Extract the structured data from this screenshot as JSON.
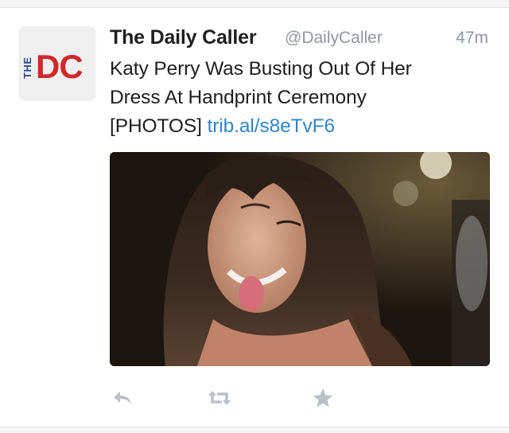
{
  "tweet": {
    "author_name": "The Daily Caller",
    "author_handle": "@DailyCaller",
    "timestamp": "47m",
    "text_line1": "Katy Perry Was Busting Out Of Her",
    "text_line2": "Dress At Handprint Ceremony",
    "text_line3_prefix": "[PHOTOS]",
    "link": "trib.al/s8eTvF6",
    "avatar_logo": {
      "vertical_word": "THE",
      "letters": "DC",
      "blue": "#2a4a8c",
      "red": "#d0272d"
    },
    "media_icon": "photo",
    "actions": [
      {
        "name": "reply",
        "icon": "reply-arrow-icon"
      },
      {
        "name": "retweet",
        "icon": "retweet-icon"
      },
      {
        "name": "favorite",
        "icon": "star-icon"
      }
    ]
  },
  "colors": {
    "text": "#1e1e1e",
    "meta": "#8b97a3",
    "link": "#2f86c9",
    "action_icon": "#b8c0c8"
  }
}
